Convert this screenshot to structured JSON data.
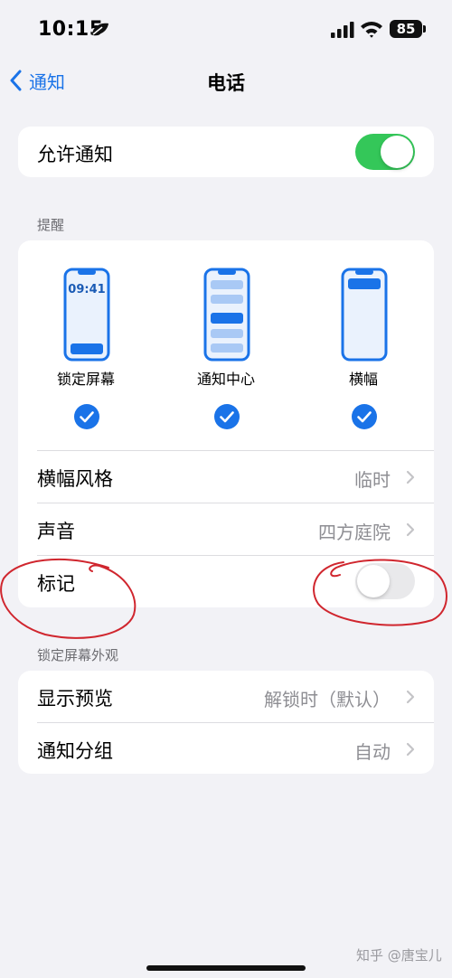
{
  "status_bar": {
    "time": "10:15",
    "battery": "85",
    "icons": [
      "focus-leaf-icon",
      "cellular-signal-icon",
      "wifi-icon",
      "battery-icon"
    ]
  },
  "nav": {
    "back_label": "通知",
    "title": "电话"
  },
  "allow_notifications": {
    "label": "允许通知",
    "enabled": true
  },
  "alerts_section": {
    "header": "提醒",
    "options": [
      {
        "label": "锁定屏幕",
        "preview_time": "09:41",
        "checked": true
      },
      {
        "label": "通知中心",
        "checked": true
      },
      {
        "label": "横幅",
        "checked": true
      }
    ],
    "rows": [
      {
        "label": "横幅风格",
        "value": "临时"
      },
      {
        "label": "声音",
        "value": "四方庭院"
      }
    ],
    "badges": {
      "label": "标记",
      "enabled": false
    }
  },
  "lock_screen_section": {
    "header": "锁定屏幕外观",
    "rows": [
      {
        "label": "显示预览",
        "value": "解锁时（默认）"
      },
      {
        "label": "通知分组",
        "value": "自动"
      }
    ]
  },
  "watermark": "知乎 @唐宝儿",
  "colors": {
    "accent": "#1a73e8",
    "switch_on": "#34c759",
    "switch_off": "#e9e9eb",
    "annotation": "#d0262e",
    "background": "#f2f2f6"
  }
}
